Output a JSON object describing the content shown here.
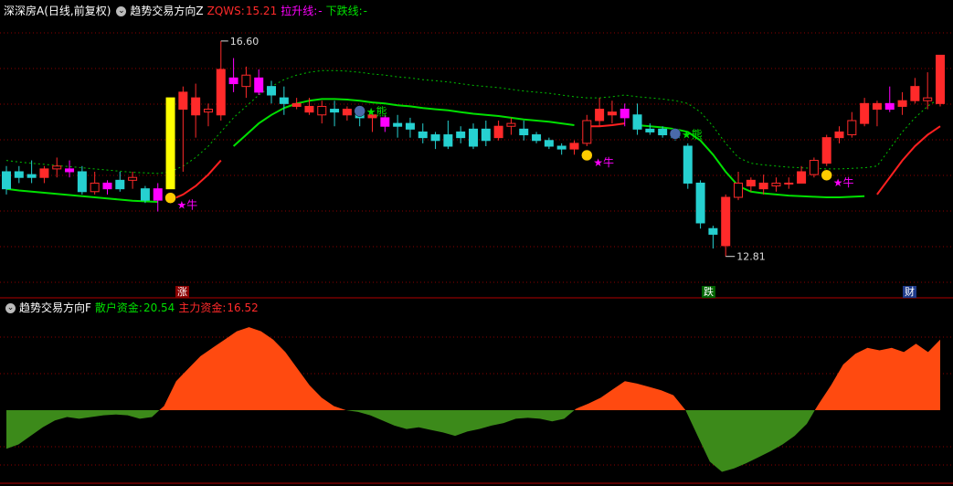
{
  "header": {
    "stock": "深深房A",
    "period": "(日线,前复权)",
    "main_indicator": "趋势交易方向Z",
    "zqws_label": "ZQWS:",
    "zqws_value": "15.21",
    "rise_line_label": "拉升线:",
    "rise_line_value": "-",
    "fall_line_label": "下跌线:",
    "fall_line_value": "-"
  },
  "sub_header": {
    "indicator": "趋势交易方向F",
    "retail_label": "散户资金:",
    "retail_value": "20.54",
    "main_label": "主力资金:",
    "main_value": "16.52"
  },
  "date_tags": [
    {
      "text": "涨",
      "bg": "#8b0000",
      "color": "#ffffff"
    },
    {
      "text": "跌",
      "bg": "#006400",
      "color": "#ffffff"
    },
    {
      "text": "财",
      "bg": "#1e3a8a",
      "color": "#ffffff"
    }
  ],
  "colors": {
    "up": "#ff2a2a",
    "down": "#26d0d0",
    "signal_up": "#ff00ff",
    "big_up": "#ffff00",
    "support_line": "#00e000",
    "dashed_line": "#00c000",
    "pressure_line": "#ff2020",
    "positive_area": "#ff4a10",
    "negative_area": "#3c8a1a",
    "grid": "#8b0000"
  },
  "chart_data": {
    "type": "candlestick",
    "price_labels": {
      "high": "16.60",
      "low": "12.81"
    },
    "ylim": [
      12.5,
      17.0
    ],
    "candles": [
      {
        "o": 14.0,
        "h": 14.4,
        "l": 13.9,
        "c": 14.3,
        "s": "down"
      },
      {
        "o": 14.3,
        "h": 14.4,
        "l": 14.1,
        "c": 14.2,
        "s": "down"
      },
      {
        "o": 14.25,
        "h": 14.5,
        "l": 14.1,
        "c": 14.2,
        "s": "down"
      },
      {
        "o": 14.2,
        "h": 14.4,
        "l": 14.1,
        "c": 14.35,
        "s": "up"
      },
      {
        "o": 14.35,
        "h": 14.55,
        "l": 14.2,
        "c": 14.4,
        "s": "up"
      },
      {
        "o": 14.35,
        "h": 14.5,
        "l": 14.2,
        "c": 14.3,
        "s": "sig"
      },
      {
        "o": 14.3,
        "h": 14.4,
        "l": 13.9,
        "c": 13.95,
        "s": "down"
      },
      {
        "o": 13.95,
        "h": 14.3,
        "l": 13.9,
        "c": 14.1,
        "s": "up"
      },
      {
        "o": 14.1,
        "h": 14.15,
        "l": 13.9,
        "c": 14.0,
        "s": "sig"
      },
      {
        "o": 14.0,
        "h": 14.3,
        "l": 13.95,
        "c": 14.15,
        "s": "down"
      },
      {
        "o": 14.15,
        "h": 14.3,
        "l": 14.0,
        "c": 14.2,
        "s": "up"
      },
      {
        "o": 14.0,
        "h": 14.05,
        "l": 13.75,
        "c": 13.8,
        "s": "down"
      },
      {
        "o": 13.8,
        "h": 14.1,
        "l": 13.6,
        "c": 14.0,
        "s": "sig"
      },
      {
        "o": 14.0,
        "h": 15.6,
        "l": 14.0,
        "c": 15.6,
        "s": "big"
      },
      {
        "o": 15.4,
        "h": 15.8,
        "l": 14.3,
        "c": 15.7,
        "s": "up"
      },
      {
        "o": 15.6,
        "h": 15.85,
        "l": 14.9,
        "c": 15.3,
        "s": "up"
      },
      {
        "o": 15.35,
        "h": 15.5,
        "l": 15.1,
        "c": 15.4,
        "s": "up"
      },
      {
        "o": 15.3,
        "h": 16.6,
        "l": 15.2,
        "c": 16.1,
        "s": "up"
      },
      {
        "o": 15.95,
        "h": 16.3,
        "l": 15.7,
        "c": 15.85,
        "s": "sig"
      },
      {
        "o": 15.8,
        "h": 16.15,
        "l": 15.6,
        "c": 16.0,
        "s": "up"
      },
      {
        "o": 15.7,
        "h": 16.1,
        "l": 15.65,
        "c": 15.95,
        "s": "sig"
      },
      {
        "o": 15.8,
        "h": 15.9,
        "l": 15.5,
        "c": 15.65,
        "s": "down"
      },
      {
        "o": 15.6,
        "h": 15.8,
        "l": 15.3,
        "c": 15.5,
        "s": "down"
      },
      {
        "o": 15.5,
        "h": 15.6,
        "l": 15.4,
        "c": 15.45,
        "s": "up"
      },
      {
        "o": 15.45,
        "h": 15.6,
        "l": 15.3,
        "c": 15.35,
        "s": "up"
      },
      {
        "o": 15.3,
        "h": 15.55,
        "l": 15.15,
        "c": 15.45,
        "s": "up"
      },
      {
        "o": 15.4,
        "h": 15.55,
        "l": 15.1,
        "c": 15.35,
        "s": "down"
      },
      {
        "o": 15.3,
        "h": 15.45,
        "l": 15.2,
        "c": 15.4,
        "s": "up"
      },
      {
        "o": 15.35,
        "h": 15.4,
        "l": 15.1,
        "c": 15.25,
        "s": "down"
      },
      {
        "o": 15.25,
        "h": 15.35,
        "l": 15.0,
        "c": 15.3,
        "s": "up"
      },
      {
        "o": 15.25,
        "h": 15.3,
        "l": 15.0,
        "c": 15.1,
        "s": "sig"
      },
      {
        "o": 15.1,
        "h": 15.3,
        "l": 14.9,
        "c": 15.15,
        "s": "down"
      },
      {
        "o": 15.15,
        "h": 15.25,
        "l": 14.9,
        "c": 15.05,
        "s": "down"
      },
      {
        "o": 15.0,
        "h": 15.15,
        "l": 14.8,
        "c": 14.9,
        "s": "down"
      },
      {
        "o": 14.85,
        "h": 15.0,
        "l": 14.7,
        "c": 14.95,
        "s": "down"
      },
      {
        "o": 14.95,
        "h": 15.2,
        "l": 14.7,
        "c": 14.75,
        "s": "down"
      },
      {
        "o": 14.9,
        "h": 15.1,
        "l": 14.8,
        "c": 15.0,
        "s": "down"
      },
      {
        "o": 14.75,
        "h": 15.15,
        "l": 14.7,
        "c": 15.05,
        "s": "down"
      },
      {
        "o": 15.05,
        "h": 15.2,
        "l": 14.75,
        "c": 14.85,
        "s": "down"
      },
      {
        "o": 14.9,
        "h": 15.2,
        "l": 14.85,
        "c": 15.1,
        "s": "up"
      },
      {
        "o": 15.1,
        "h": 15.25,
        "l": 14.95,
        "c": 15.15,
        "s": "up"
      },
      {
        "o": 15.05,
        "h": 15.2,
        "l": 14.85,
        "c": 14.95,
        "s": "down"
      },
      {
        "o": 14.95,
        "h": 15.0,
        "l": 14.8,
        "c": 14.85,
        "s": "down"
      },
      {
        "o": 14.85,
        "h": 14.9,
        "l": 14.7,
        "c": 14.75,
        "s": "down"
      },
      {
        "o": 14.75,
        "h": 14.8,
        "l": 14.6,
        "c": 14.7,
        "s": "down"
      },
      {
        "o": 14.7,
        "h": 14.85,
        "l": 14.6,
        "c": 14.8,
        "s": "up"
      },
      {
        "o": 14.8,
        "h": 15.3,
        "l": 14.75,
        "c": 15.2,
        "s": "up"
      },
      {
        "o": 15.2,
        "h": 15.6,
        "l": 15.1,
        "c": 15.4,
        "s": "up"
      },
      {
        "o": 15.35,
        "h": 15.55,
        "l": 15.15,
        "c": 15.3,
        "s": "up"
      },
      {
        "o": 15.25,
        "h": 15.5,
        "l": 15.1,
        "c": 15.4,
        "s": "sig"
      },
      {
        "o": 15.3,
        "h": 15.5,
        "l": 14.95,
        "c": 15.05,
        "s": "down"
      },
      {
        "o": 15.0,
        "h": 15.15,
        "l": 14.95,
        "c": 15.05,
        "s": "down"
      },
      {
        "o": 15.05,
        "h": 15.1,
        "l": 14.9,
        "c": 14.95,
        "s": "down"
      },
      {
        "o": 14.95,
        "h": 15.0,
        "l": 14.85,
        "c": 14.9,
        "s": "down"
      },
      {
        "o": 14.75,
        "h": 14.8,
        "l": 14.0,
        "c": 14.1,
        "s": "down"
      },
      {
        "o": 14.1,
        "h": 14.15,
        "l": 13.3,
        "c": 13.4,
        "s": "down"
      },
      {
        "o": 13.3,
        "h": 13.35,
        "l": 12.95,
        "c": 13.2,
        "s": "down"
      },
      {
        "o": 13.0,
        "h": 13.9,
        "l": 12.81,
        "c": 13.85,
        "s": "up"
      },
      {
        "o": 13.85,
        "h": 14.3,
        "l": 13.8,
        "c": 14.1,
        "s": "up"
      },
      {
        "o": 14.05,
        "h": 14.2,
        "l": 13.95,
        "c": 14.15,
        "s": "up"
      },
      {
        "o": 14.0,
        "h": 14.25,
        "l": 13.9,
        "c": 14.1,
        "s": "up"
      },
      {
        "o": 14.05,
        "h": 14.2,
        "l": 13.95,
        "c": 14.1,
        "s": "up"
      },
      {
        "o": 14.1,
        "h": 14.2,
        "l": 14.0,
        "c": 14.1,
        "s": "up"
      },
      {
        "o": 14.1,
        "h": 14.4,
        "l": 14.1,
        "c": 14.3,
        "s": "up"
      },
      {
        "o": 14.25,
        "h": 14.55,
        "l": 14.2,
        "c": 14.5,
        "s": "up"
      },
      {
        "o": 14.45,
        "h": 14.95,
        "l": 14.4,
        "c": 14.9,
        "s": "up"
      },
      {
        "o": 14.9,
        "h": 15.1,
        "l": 14.8,
        "c": 15.0,
        "s": "up"
      },
      {
        "o": 14.95,
        "h": 15.35,
        "l": 14.9,
        "c": 15.2,
        "s": "up"
      },
      {
        "o": 15.15,
        "h": 15.6,
        "l": 15.1,
        "c": 15.5,
        "s": "up"
      },
      {
        "o": 15.4,
        "h": 15.55,
        "l": 15.1,
        "c": 15.5,
        "s": "up"
      },
      {
        "o": 15.4,
        "h": 15.8,
        "l": 15.35,
        "c": 15.5,
        "s": "sig"
      },
      {
        "o": 15.45,
        "h": 15.7,
        "l": 15.3,
        "c": 15.55,
        "s": "up"
      },
      {
        "o": 15.55,
        "h": 15.95,
        "l": 15.5,
        "c": 15.8,
        "s": "up"
      },
      {
        "o": 15.55,
        "h": 16.05,
        "l": 15.4,
        "c": 15.6,
        "s": "up"
      },
      {
        "o": 15.5,
        "h": 16.3,
        "l": 15.45,
        "c": 16.35,
        "s": "up"
      }
    ],
    "support_line": [
      14.0,
      13.97,
      13.95,
      13.93,
      13.91,
      13.89,
      13.87,
      13.85,
      13.83,
      13.81,
      13.79,
      13.78,
      13.77,
      13.8,
      13.9,
      14.05,
      14.25,
      14.5,
      14.75,
      14.95,
      15.15,
      15.3,
      15.42,
      15.5,
      15.55,
      15.58,
      15.58,
      15.57,
      15.55,
      15.52,
      15.5,
      15.47,
      15.45,
      15.42,
      15.4,
      15.38,
      15.35,
      15.32,
      15.3,
      15.28,
      15.25,
      15.22,
      15.2,
      15.18,
      15.15,
      15.12,
      15.1,
      15.1,
      15.12,
      15.15,
      15.12,
      15.1,
      15.08,
      15.05,
      15.0,
      14.85,
      14.6,
      14.3,
      14.05,
      13.95,
      13.92,
      13.9,
      13.88,
      13.87,
      13.86,
      13.85,
      13.85,
      13.86,
      13.87,
      13.9,
      14.2,
      14.5,
      14.75,
      14.95,
      15.1
    ],
    "sub_values": [
      -4.5,
      -4,
      -3,
      -2,
      -1.2,
      -0.8,
      -1.0,
      -0.8,
      -0.6,
      -0.5,
      -0.6,
      -1.0,
      -0.8,
      0.5,
      3.5,
      5.0,
      6.5,
      7.5,
      8.5,
      9.5,
      10.0,
      9.5,
      8.5,
      7.0,
      5.0,
      3.0,
      1.5,
      0.5,
      0.0,
      -0.2,
      -0.6,
      -1.2,
      -1.8,
      -2.2,
      -2.0,
      -2.3,
      -2.6,
      -3.0,
      -2.5,
      -2.2,
      -1.8,
      -1.5,
      -1.0,
      -0.9,
      -1.0,
      -1.3,
      -1.0,
      0.2,
      0.8,
      1.5,
      2.5,
      3.5,
      3.2,
      2.8,
      2.4,
      1.8,
      0.0,
      -3.0,
      -6.0,
      -7.2,
      -6.8,
      -6.2,
      -5.5,
      -4.8,
      -4.0,
      -3.0,
      -1.6,
      0.8,
      3.0,
      5.5,
      6.8,
      7.5,
      7.2,
      7.5,
      7.0,
      8.0,
      7.0,
      8.5
    ],
    "sub_ylim": [
      -8,
      11
    ]
  }
}
